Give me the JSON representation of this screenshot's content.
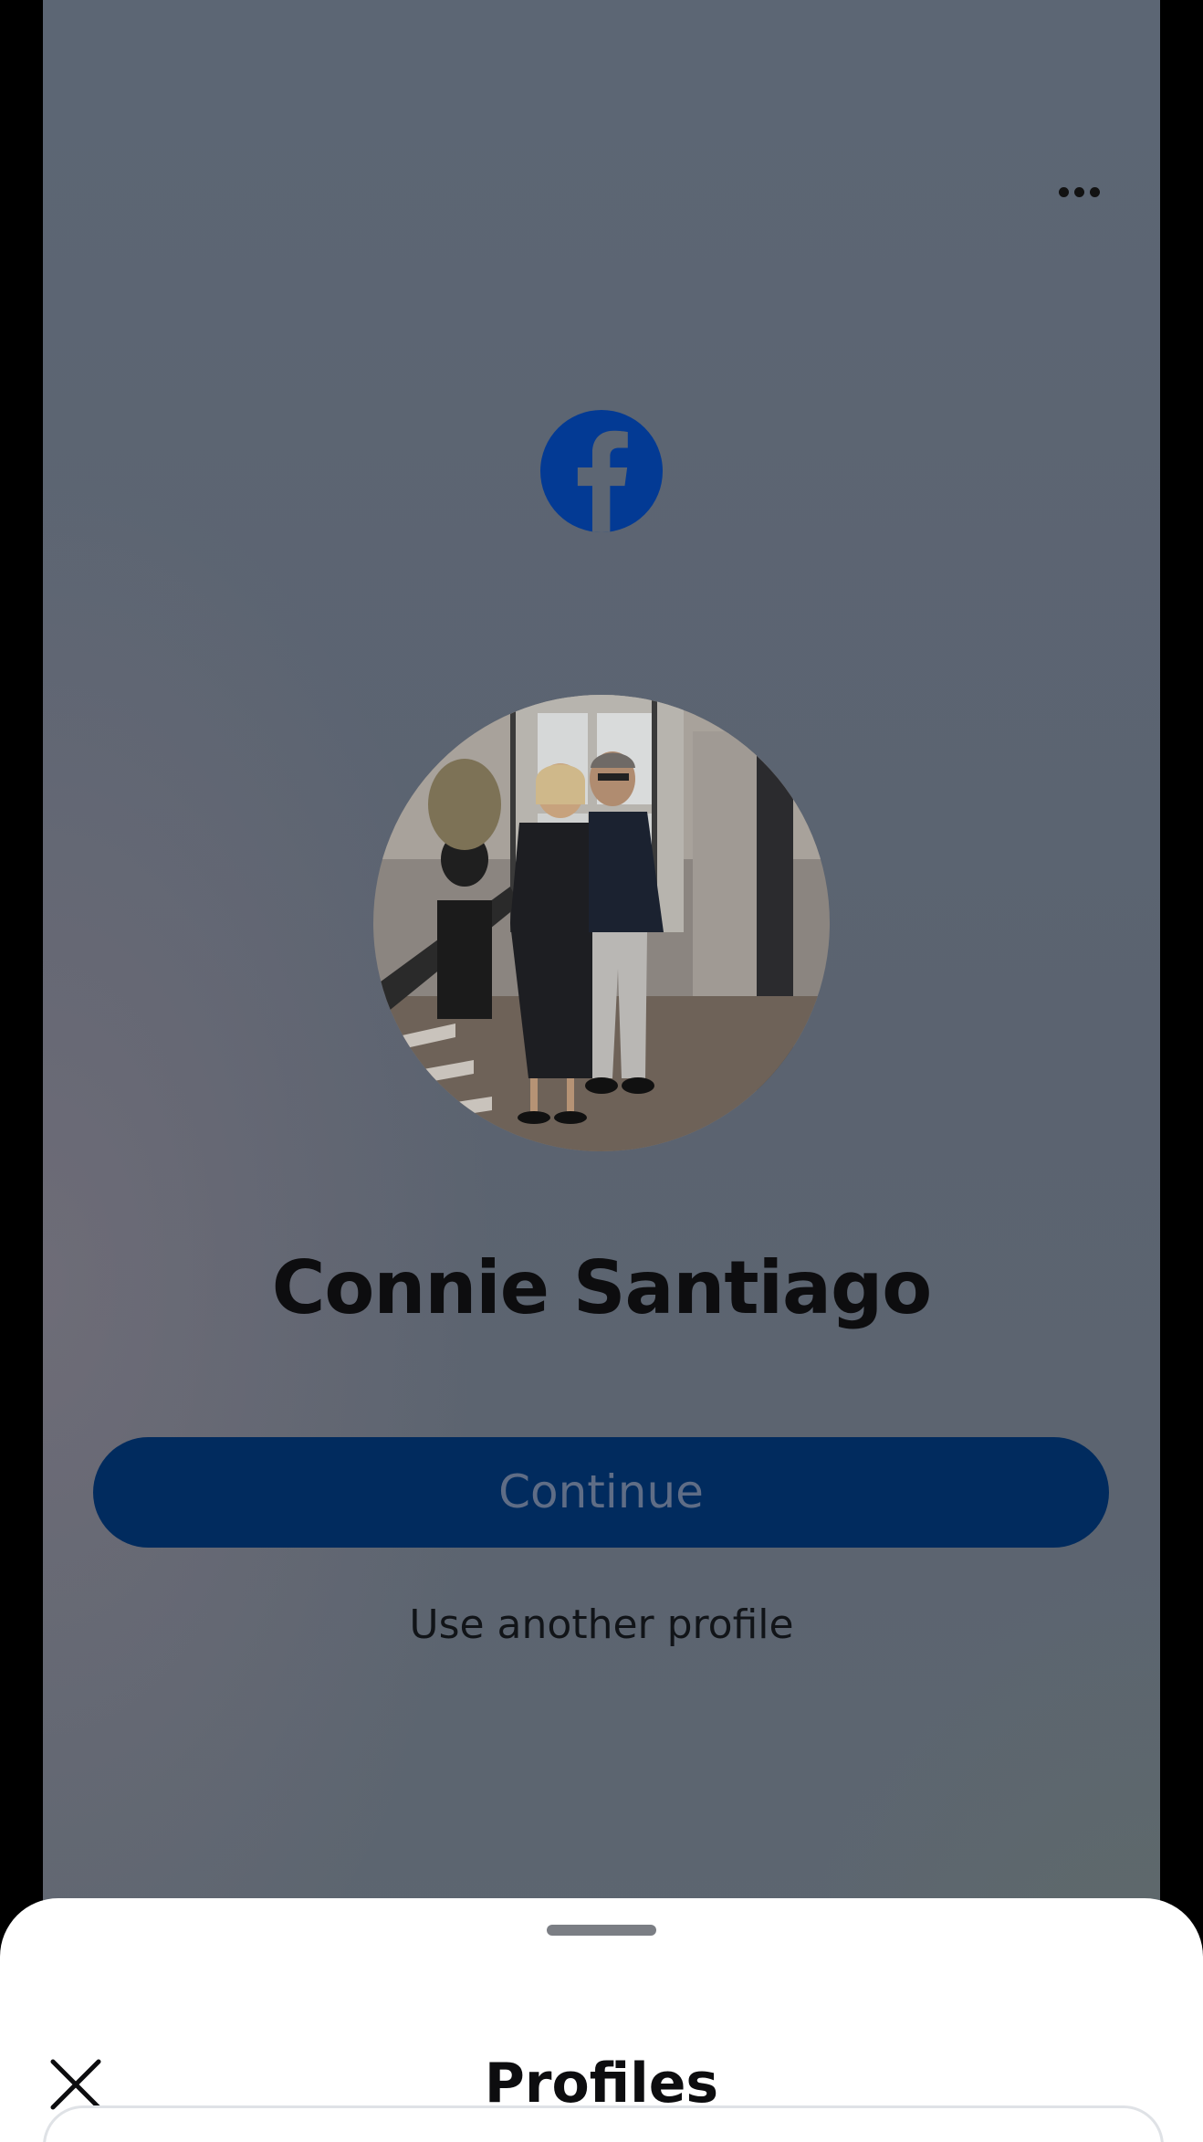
{
  "header": {
    "more_icon": "more-horizontal-icon"
  },
  "brand": {
    "logo_icon": "facebook-logo-icon",
    "logo_color": "#033a94"
  },
  "profile": {
    "name": "Connie Santiago",
    "avatar_icon": "profile-photo"
  },
  "actions": {
    "continue_label": "Continue",
    "continue_color": "#012b5e",
    "other_profile_label": "Use another profile"
  },
  "sheet": {
    "title": "Profiles",
    "close_icon": "close-icon"
  }
}
